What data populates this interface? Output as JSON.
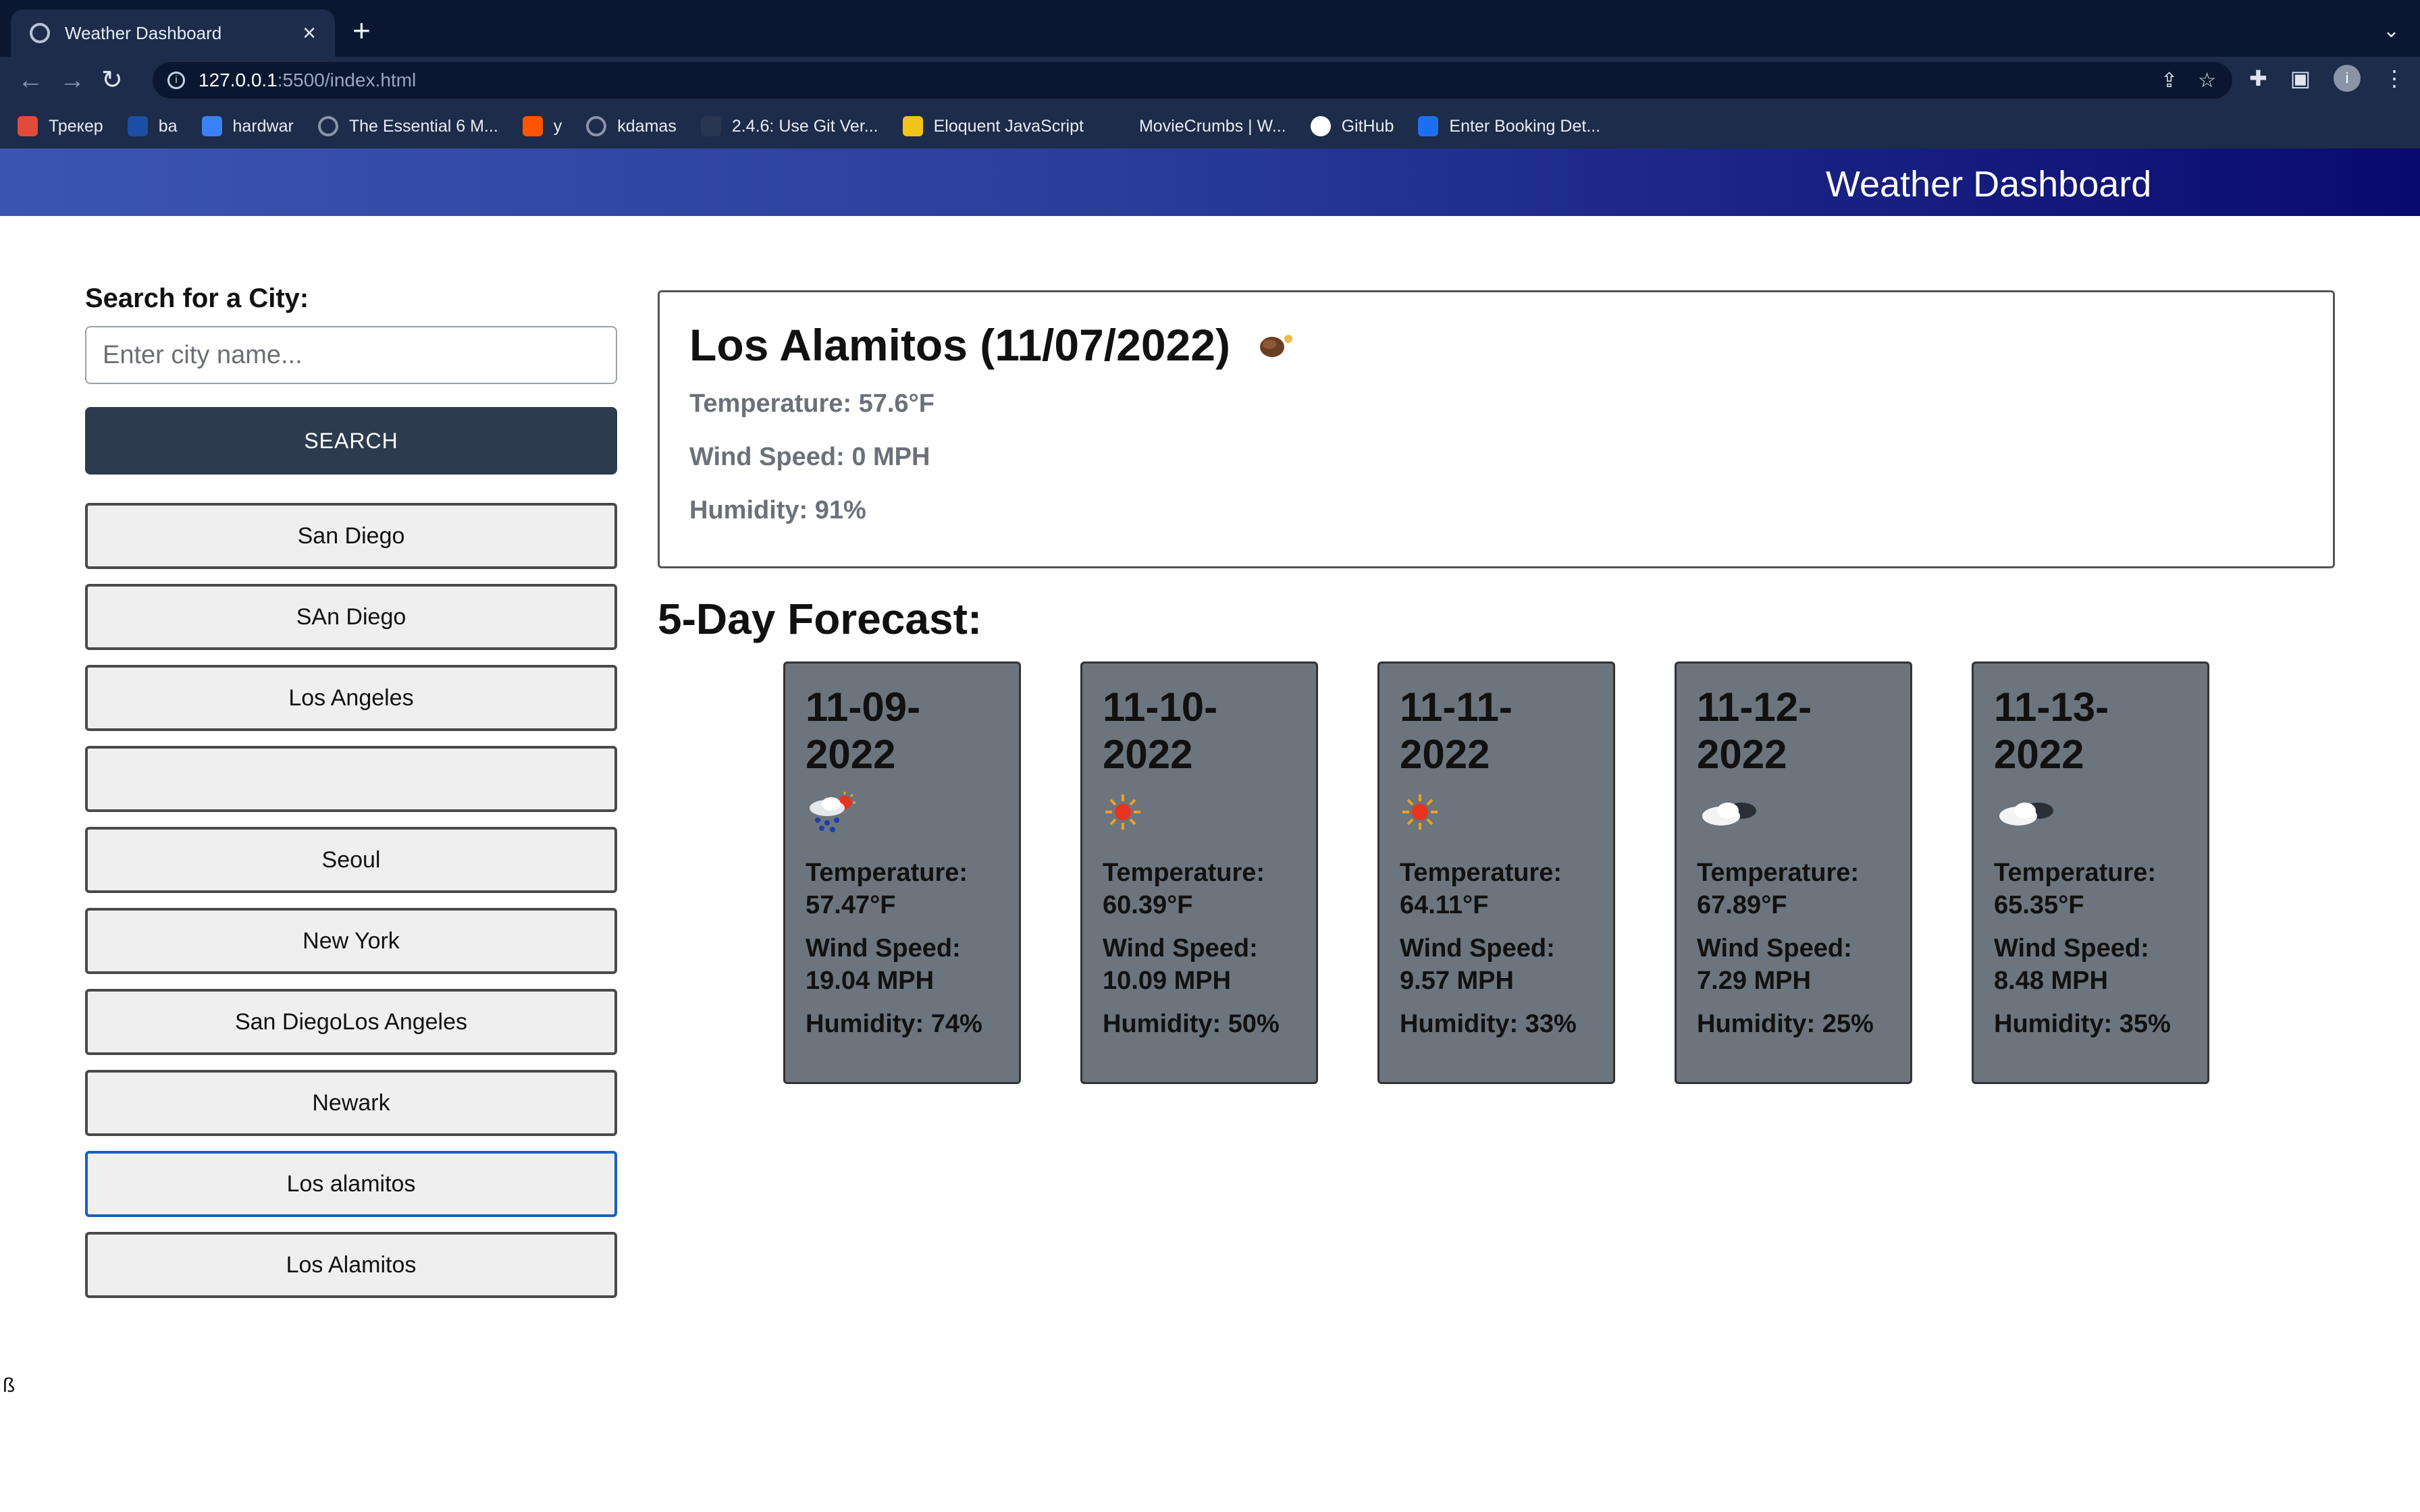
{
  "browser": {
    "tab_title": "Weather Dashboard",
    "url_host": "127.0.0.1",
    "url_path": ":5500/index.html",
    "profile_initial": "i",
    "bookmarks": [
      {
        "label": "Трекер",
        "icon": "multicolor-icon",
        "color": "#e04b3c"
      },
      {
        "label": "ba",
        "icon": "uci-icon",
        "color": "#1a4fa3"
      },
      {
        "label": "hardwar",
        "icon": "gear-icon",
        "color": "#3b82f6"
      },
      {
        "label": "The Essential 6 M...",
        "icon": "globe-icon",
        "color": "#8a94a6"
      },
      {
        "label": "y",
        "icon": "soundcloud-icon",
        "color": "#ff5500"
      },
      {
        "label": "kdamas",
        "icon": "globe-icon",
        "color": "#8a94a6"
      },
      {
        "label": "2.4.6: Use Git Ver...",
        "icon": "doc-icon",
        "color": "#2a3550"
      },
      {
        "label": "Eloquent JavaScript",
        "icon": "js-icon",
        "color": "#f0c419"
      },
      {
        "label": "MovieCrumbs | W...",
        "icon": "play-icon",
        "color": "#1c2c4a"
      },
      {
        "label": "GitHub",
        "icon": "github-icon",
        "color": "#ffffff"
      },
      {
        "label": "Enter Booking Det...",
        "icon": "booking-icon",
        "color": "#1d6ff2"
      }
    ]
  },
  "header": {
    "title": "Weather Dashboard"
  },
  "sidebar": {
    "search_label": "Search for a City:",
    "search_placeholder": "Enter city name...",
    "search_button": "SEARCH",
    "history": [
      "San Diego",
      "SAn Diego",
      "Los Angeles",
      "",
      "Seoul",
      "New York",
      "San DiegoLos Angeles",
      "Newark",
      "Los alamitos",
      "Los Alamitos"
    ]
  },
  "current": {
    "title": "Los Alamitos (11/07/2022)",
    "icon": "mist-icon",
    "temperature": "Temperature: 57.6°F",
    "wind": "Wind Speed: 0 MPH",
    "humidity": "Humidity: 91%"
  },
  "forecast": {
    "heading": "5-Day Forecast:",
    "days": [
      {
        "date": "11-09-2022",
        "icon": "rain-sun-icon",
        "temperature": "Temperature: 57.47°F",
        "wind": "Wind Speed: 19.04 MPH",
        "humidity": "Humidity: 74%"
      },
      {
        "date": "11-10-2022",
        "icon": "sun-icon",
        "temperature": "Temperature: 60.39°F",
        "wind": "Wind Speed: 10.09 MPH",
        "humidity": "Humidity: 50%"
      },
      {
        "date": "11-11-2022",
        "icon": "sun-icon",
        "temperature": "Temperature: 64.11°F",
        "wind": "Wind Speed: 9.57 MPH",
        "humidity": "Humidity: 33%"
      },
      {
        "date": "11-12-2022",
        "icon": "cloud-icon",
        "temperature": "Temperature: 67.89°F",
        "wind": "Wind Speed: 7.29 MPH",
        "humidity": "Humidity: 25%"
      },
      {
        "date": "11-13-2022",
        "icon": "cloud-icon",
        "temperature": "Temperature: 65.35°F",
        "wind": "Wind Speed: 8.48 MPH",
        "humidity": "Humidity: 35%"
      }
    ]
  },
  "footer_text": "ß"
}
